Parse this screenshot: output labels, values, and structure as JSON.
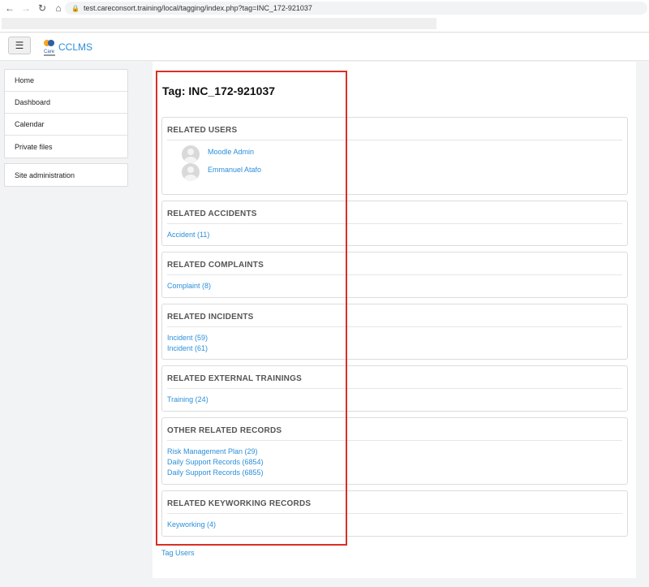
{
  "browser": {
    "url": "test.careconsort.training/local/tagging/index.php?tag=INC_172-921037"
  },
  "navbar": {
    "menu_icon": "☰",
    "brand": "CCLMS",
    "logo_text": "Care"
  },
  "sidebar": {
    "items": [
      {
        "label": "Home"
      },
      {
        "label": "Dashboard"
      },
      {
        "label": "Calendar"
      },
      {
        "label": "Private files"
      }
    ],
    "admin": {
      "label": "Site administration"
    }
  },
  "page": {
    "title": "Tag: INC_172-921037"
  },
  "sections": {
    "users": {
      "header": "RELATED USERS",
      "items": [
        {
          "name": "Moodle Admin"
        },
        {
          "name": "Emmanuel Atafo"
        }
      ]
    },
    "accidents": {
      "header": "RELATED ACCIDENTS",
      "links": [
        "Accident (11)"
      ]
    },
    "complaints": {
      "header": "RELATED COMPLAINTS",
      "links": [
        "Complaint (8)"
      ]
    },
    "incidents": {
      "header": "RELATED INCIDENTS",
      "links": [
        "Incident (59)",
        "Incident (61)"
      ]
    },
    "trainings": {
      "header": "RELATED EXTERNAL TRAININGS",
      "links": [
        "Training (24)"
      ]
    },
    "other": {
      "header": "OTHER RELATED RECORDS",
      "links": [
        "Risk Management Plan (29)",
        "Daily Support Records (6854)",
        "Daily Support Records (6855)"
      ]
    },
    "keyworking": {
      "header": "RELATED KEYWORKING RECORDS",
      "links": [
        "Keyworking (4)"
      ]
    }
  },
  "footer": {
    "tag_users": "Tag Users"
  },
  "colors": {
    "link": "#2b8fd8",
    "highlight": "#d93025"
  }
}
